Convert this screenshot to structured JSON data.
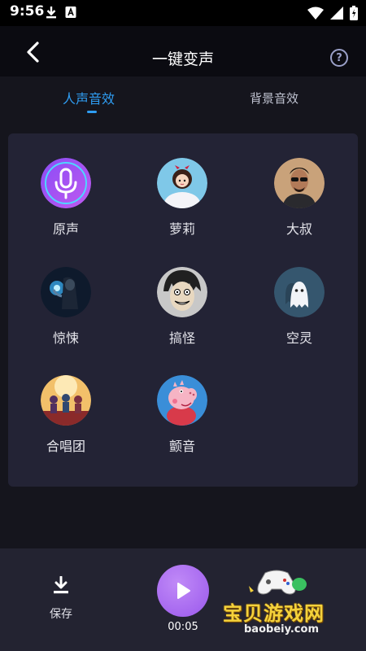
{
  "status_bar": {
    "time": "9:56",
    "icons": [
      "download-icon",
      "a-badge-icon",
      "wifi-icon",
      "signal-icon",
      "battery-icon"
    ]
  },
  "header": {
    "title": "一键变声",
    "back_icon": "chevron-left-icon",
    "help_icon": "help-icon",
    "help_glyph": "?"
  },
  "tabs": [
    {
      "label": "人声音效",
      "active": true
    },
    {
      "label": "背景音效",
      "active": false
    }
  ],
  "effects": [
    {
      "label": "原声",
      "icon": "microphone-icon"
    },
    {
      "label": "萝莉",
      "icon": "loli-avatar"
    },
    {
      "label": "大叔",
      "icon": "uncle-avatar"
    },
    {
      "label": "惊悚",
      "icon": "thriller-avatar"
    },
    {
      "label": "搞怪",
      "icon": "funny-avatar"
    },
    {
      "label": "空灵",
      "icon": "ghost-avatar"
    },
    {
      "label": "合唱团",
      "icon": "chorus-avatar"
    },
    {
      "label": "颤音",
      "icon": "peppa-avatar"
    }
  ],
  "bottom_bar": {
    "save_label": "保存",
    "play_time": "00:05"
  },
  "watermark": {
    "text": "宝贝游戏网",
    "domain": "baobeiy.com"
  },
  "colors": {
    "accent": "#2f9df2",
    "panel": "#232335",
    "play_button": "#a866f0",
    "watermark": "#f4d23c"
  }
}
